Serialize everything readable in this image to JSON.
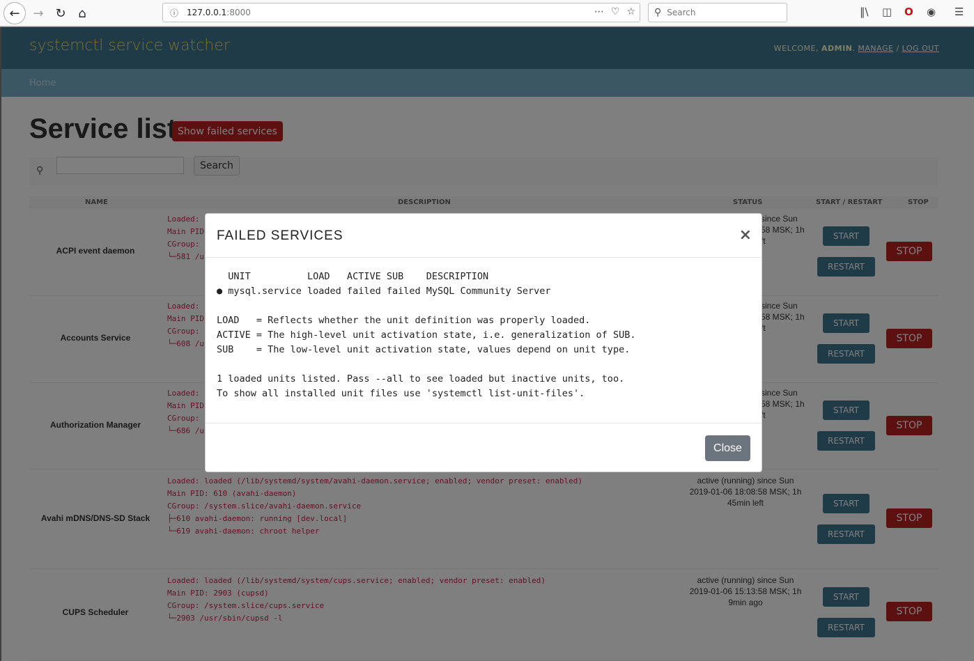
{
  "browser": {
    "url_host": "127.0.0.1",
    "url_port": ":8000",
    "search_placeholder": "Search"
  },
  "header": {
    "site_title": "systemctl service watcher",
    "welcome": "WELCOME, ",
    "username": "ADMIN",
    "manage": "MANAGE",
    "separator": " / ",
    "logout": "LOG OUT"
  },
  "breadcrumbs": {
    "home": "Home"
  },
  "content": {
    "title": "Service list",
    "show_failed_label": "Show failed services",
    "search_button": "Search"
  },
  "table": {
    "headers": {
      "name": "NAME",
      "description": "DESCRIPTION",
      "status": "STATUS",
      "start_restart": "START / RESTART",
      "stop": "STOP"
    },
    "start_label": "START",
    "restart_label": "RESTART",
    "stop_label": "STOP",
    "rows": [
      {
        "name": "ACPI event daemon",
        "desc": "Loaded:\nMain PID\nCGroup:\n└─581 /u",
        "status": "since Sun\n58 MSK; 1h\nft"
      },
      {
        "name": "Accounts Service",
        "desc": "Loaded:\nMain PID\nCGroup:\n└─608 /u",
        "status": "since Sun\n58 MSK; 1h\nft"
      },
      {
        "name": "Authorization Manager",
        "desc": "Loaded:\nMain PID\nCGroup:\n└─686 /u",
        "status": "since Sun\n58 MSK; 1h\nft"
      },
      {
        "name": "Avahi mDNS/DNS-SD Stack",
        "desc": "Loaded: loaded (/lib/systemd/system/avahi-daemon.service; enabled; vendor preset: enabled)\nMain PID: 610 (avahi-daemon)\nCGroup: /system.slice/avahi-daemon.service\n├─610 avahi-daemon: running [dev.local]\n└─619 avahi-daemon: chroot helper",
        "status": "active (running) since Sun\n2019-01-06 18:08:58 MSK; 1h\n45min left"
      },
      {
        "name": "CUPS Scheduler",
        "desc": "Loaded: loaded (/lib/systemd/system/cups.service; enabled; vendor preset: enabled)\nMain PID: 2903 (cupsd)\nCGroup: /system.slice/cups.service\n└─2903 /usr/sbin/cupsd -l",
        "status": "active (running) since Sun\n2019-01-06 15:13:58 MSK; 1h\n9min ago"
      }
    ]
  },
  "modal": {
    "title": "FAILED SERVICES",
    "close_x": "×",
    "body": "  UNIT          LOAD   ACTIVE SUB    DESCRIPTION\n● mysql.service loaded failed failed MySQL Community Server\n\nLOAD   = Reflects whether the unit definition was properly loaded.\nACTIVE = The high-level unit activation state, i.e. generalization of SUB.\nSUB    = The low-level unit activation state, values depend on unit type.\n\n1 loaded units listed. Pass --all to see loaded but inactive units, too.\nTo show all installed unit files use 'systemctl list-unit-files'.",
    "close_button": "Close"
  }
}
